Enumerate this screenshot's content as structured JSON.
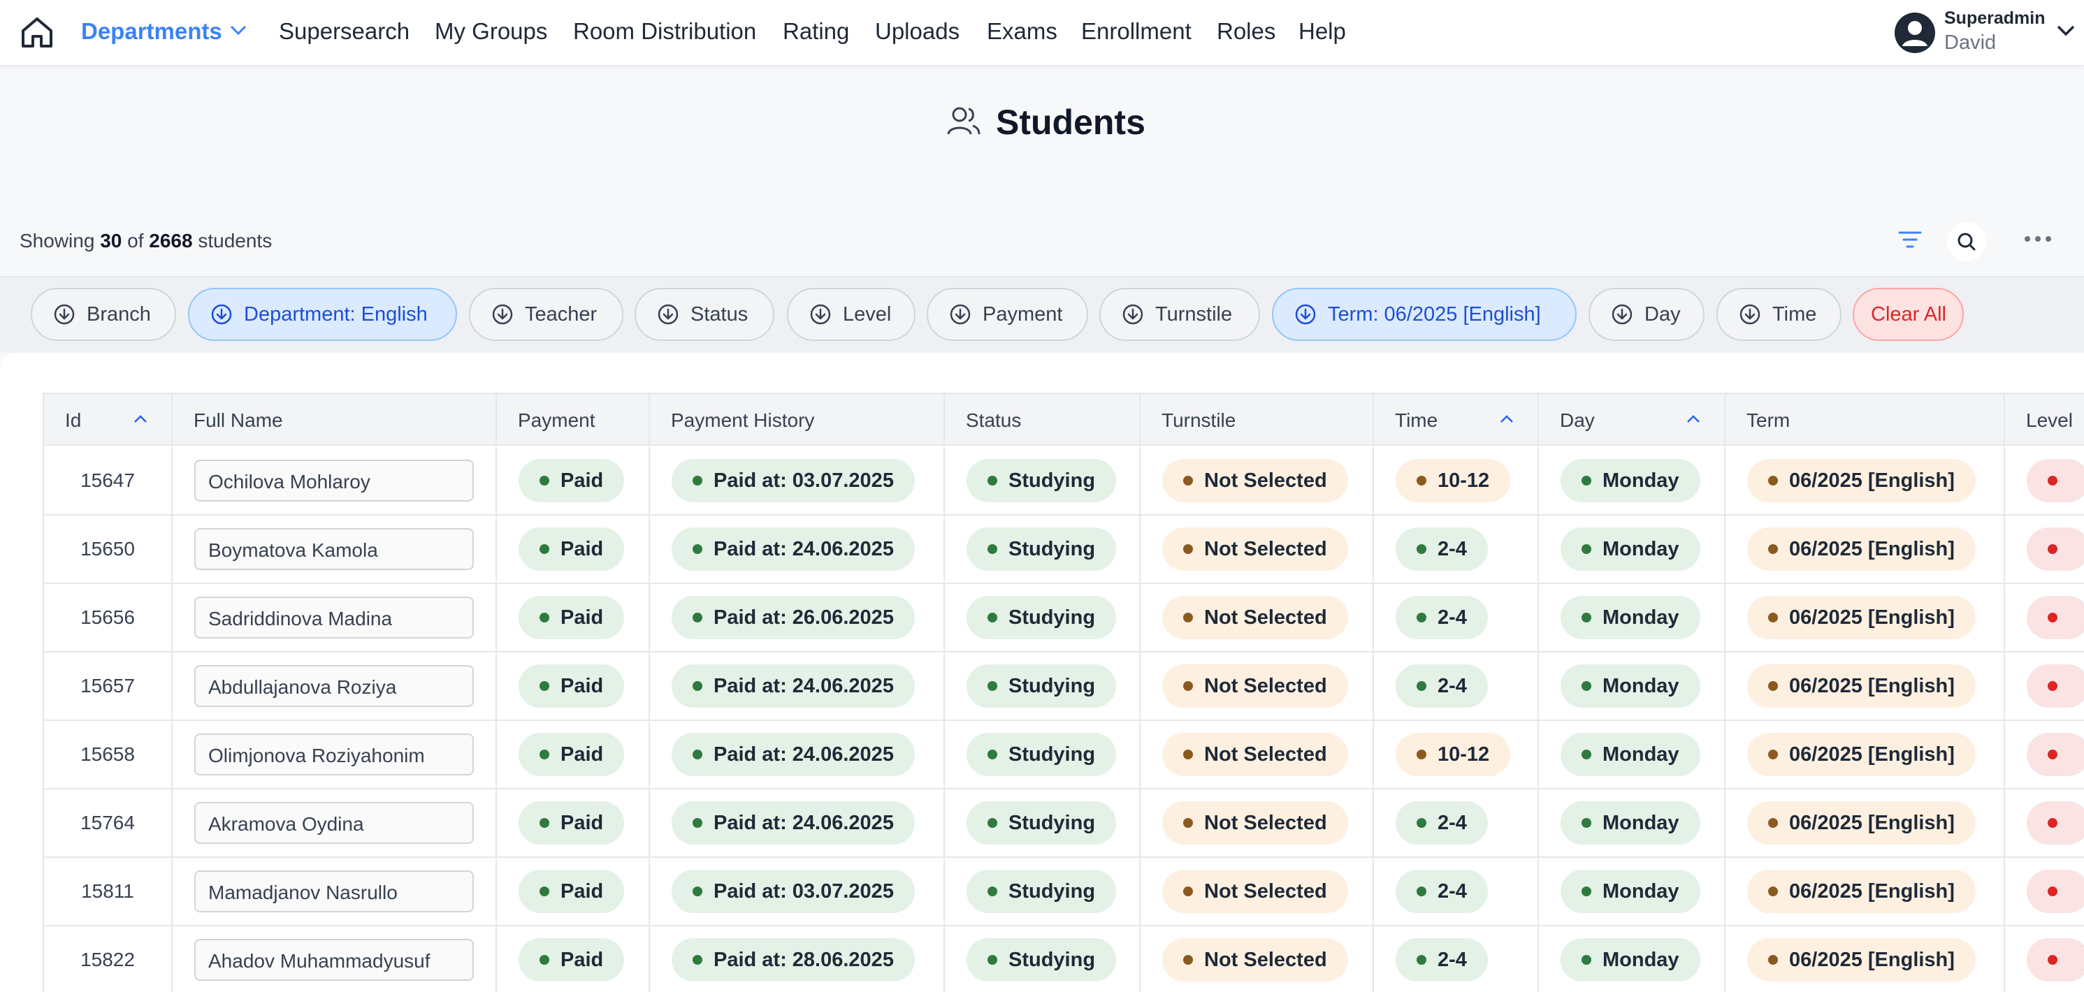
{
  "nav": {
    "items": [
      "Departments",
      "Supersearch",
      "My Groups",
      "Room Distribution",
      "Rating",
      "Uploads",
      "Exams",
      "Enrollment",
      "Roles",
      "Help"
    ],
    "active": "Departments",
    "user_role": "Superadmin",
    "user_name": "David"
  },
  "header": {
    "title": "Students"
  },
  "summary": {
    "prefix": "Showing",
    "shown": "30",
    "of": "of",
    "total": "2668",
    "suffix": "students"
  },
  "filters": [
    "Branch",
    "Department: English",
    "Teacher",
    "Status",
    "Level",
    "Payment",
    "Turnstile",
    "Term: 06/2025 [English]",
    "Day",
    "Time"
  ],
  "active_filters": [
    "Department: English",
    "Term: 06/2025 [English]"
  ],
  "clear_label": "Clear All",
  "table": {
    "headers": [
      "Id",
      "Full Name",
      "Payment",
      "Payment History",
      "Status",
      "Turnstile",
      "Time",
      "Day",
      "Term",
      "Level"
    ],
    "sorted_columns": [
      "Id",
      "Time",
      "Day"
    ],
    "rows": [
      {
        "id": "15647",
        "name": "Ochilova Mohlaroy",
        "payment": "Paid",
        "history": "Paid at: 03.07.2025",
        "status": "Studying",
        "turnstile": "Not Selected",
        "time": "10-12",
        "day": "Monday",
        "term": "06/2025 [English]"
      },
      {
        "id": "15650",
        "name": "Boymatova Kamola",
        "payment": "Paid",
        "history": "Paid at: 24.06.2025",
        "status": "Studying",
        "turnstile": "Not Selected",
        "time": "2-4",
        "day": "Monday",
        "term": "06/2025 [English]"
      },
      {
        "id": "15656",
        "name": "Sadriddinova Madina",
        "payment": "Paid",
        "history": "Paid at: 26.06.2025",
        "status": "Studying",
        "turnstile": "Not Selected",
        "time": "2-4",
        "day": "Monday",
        "term": "06/2025 [English]"
      },
      {
        "id": "15657",
        "name": "Abdullajanova Roziya",
        "payment": "Paid",
        "history": "Paid at: 24.06.2025",
        "status": "Studying",
        "turnstile": "Not Selected",
        "time": "2-4",
        "day": "Monday",
        "term": "06/2025 [English]"
      },
      {
        "id": "15658",
        "name": "Olimjonova Roziyahonim",
        "payment": "Paid",
        "history": "Paid at: 24.06.2025",
        "status": "Studying",
        "turnstile": "Not Selected",
        "time": "10-12",
        "day": "Monday",
        "term": "06/2025 [English]"
      },
      {
        "id": "15764",
        "name": "Akramova Oydina",
        "payment": "Paid",
        "history": "Paid at: 24.06.2025",
        "status": "Studying",
        "turnstile": "Not Selected",
        "time": "2-4",
        "day": "Monday",
        "term": "06/2025 [English]"
      },
      {
        "id": "15811",
        "name": "Mamadjanov Nasrullo",
        "payment": "Paid",
        "history": "Paid at: 03.07.2025",
        "status": "Studying",
        "turnstile": "Not Selected",
        "time": "2-4",
        "day": "Monday",
        "term": "06/2025 [English]"
      },
      {
        "id": "15822",
        "name": "Ahadov Muhammadyusuf",
        "payment": "Paid",
        "history": "Paid at: 28.06.2025",
        "status": "Studying",
        "turnstile": "Not Selected",
        "time": "2-4",
        "day": "Monday",
        "term": "06/2025 [English]"
      }
    ]
  },
  "icons": [
    "home-icon",
    "chevron-down-icon",
    "user-avatar-icon",
    "users-icon",
    "filter-icon",
    "search-icon",
    "more-icon",
    "arrow-down-circle-icon",
    "sort-up-icon"
  ],
  "colors": {
    "accent": "#3b82f6",
    "paid_green": "#e3f1e6",
    "warn_orange": "#fdf0e1",
    "danger_red": "#fbe3e3"
  }
}
